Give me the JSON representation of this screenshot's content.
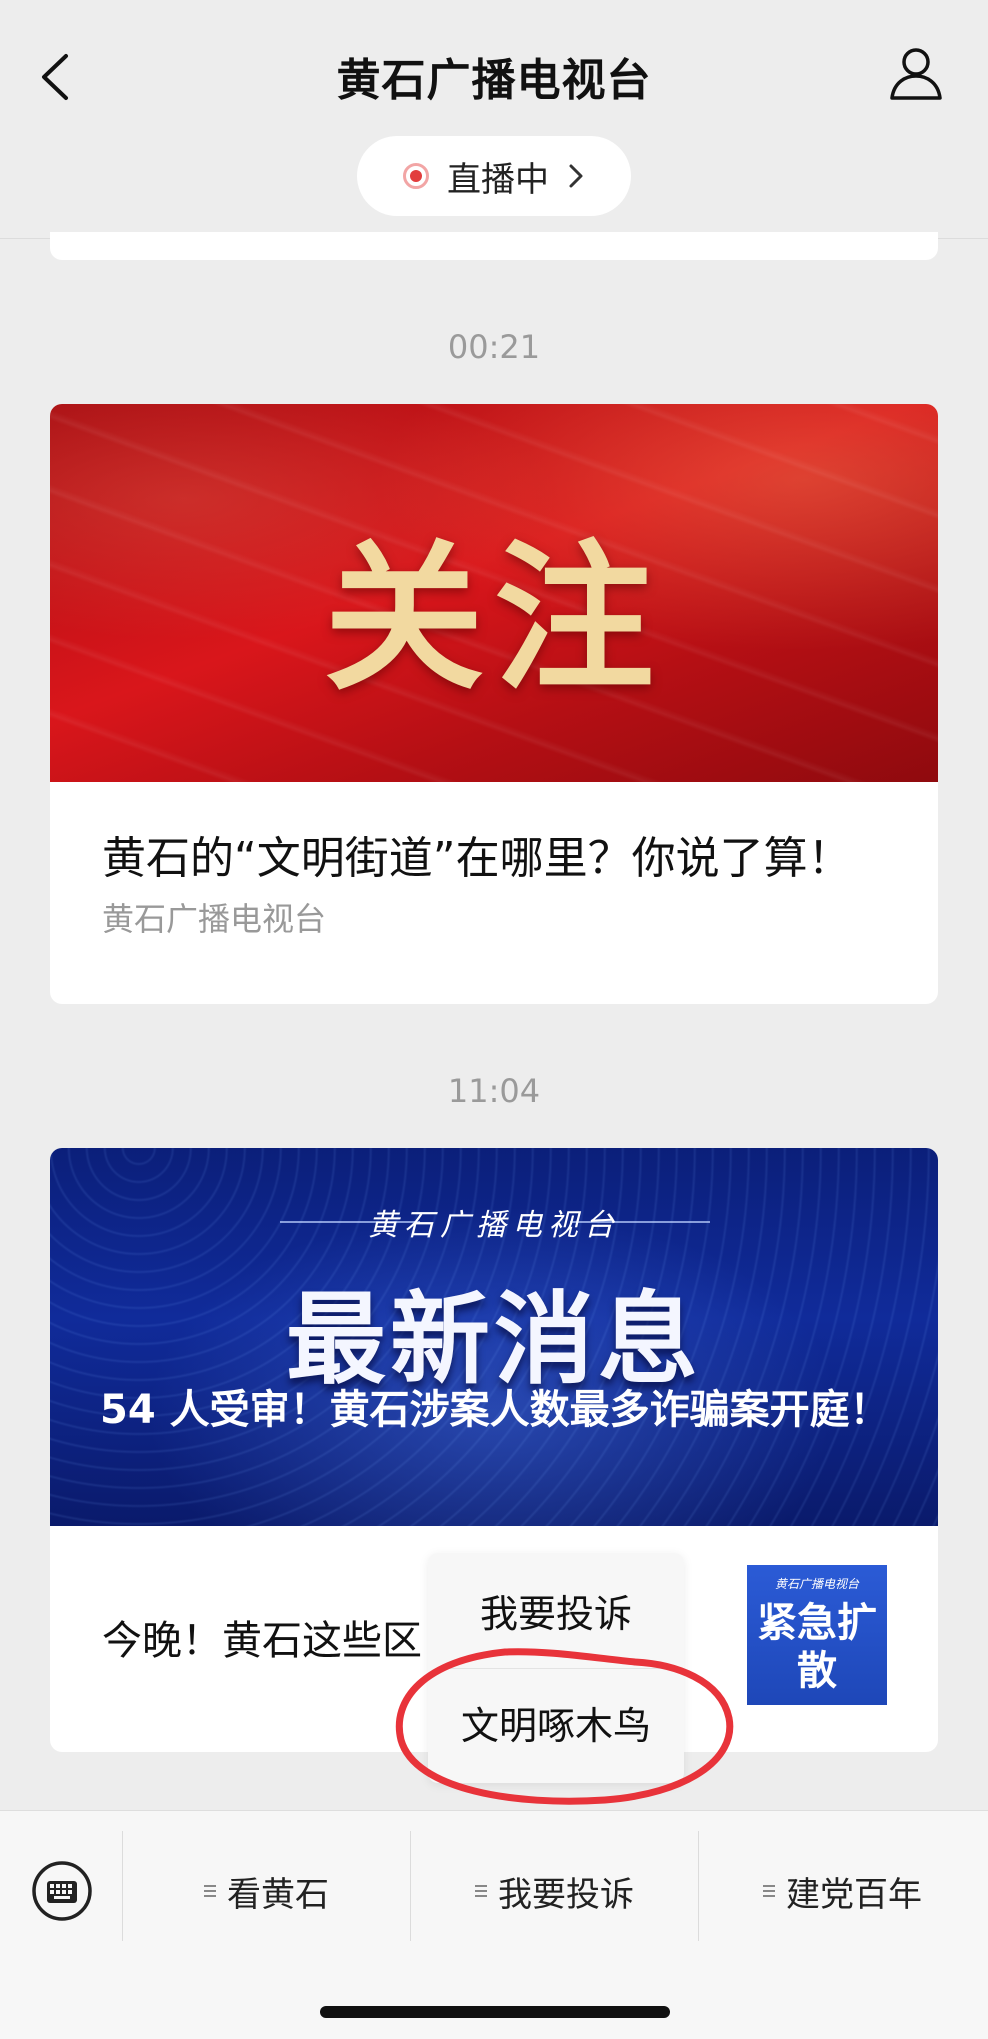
{
  "header": {
    "title": "黄石广播电视台",
    "live_label": "直播中"
  },
  "feed": {
    "items": [
      {
        "time": "00:21",
        "banner_text": "关注",
        "title": "黄石的“文明街道”在哪里？你说了算！",
        "source": "黄石广播电视台"
      },
      {
        "time": "11:04",
        "banner_subtitle": "黄石广播电视台",
        "banner_big": "最新消息",
        "headline": "54 人受审！黄石涉案人数最多诈骗案开庭！",
        "sub_title": "今晚！黄石这些区",
        "thumb_small": "黄石广播电视台",
        "thumb_text": "紧急扩散"
      }
    ]
  },
  "popup_menu": {
    "items": [
      "我要投诉",
      "文明啄木鸟"
    ],
    "highlight_color": "#e8333a"
  },
  "bottom_menu": {
    "items": [
      "看黄石",
      "我要投诉",
      "建党百年"
    ]
  },
  "colors": {
    "live_dot": "#e23d3d",
    "background": "#ededed"
  }
}
